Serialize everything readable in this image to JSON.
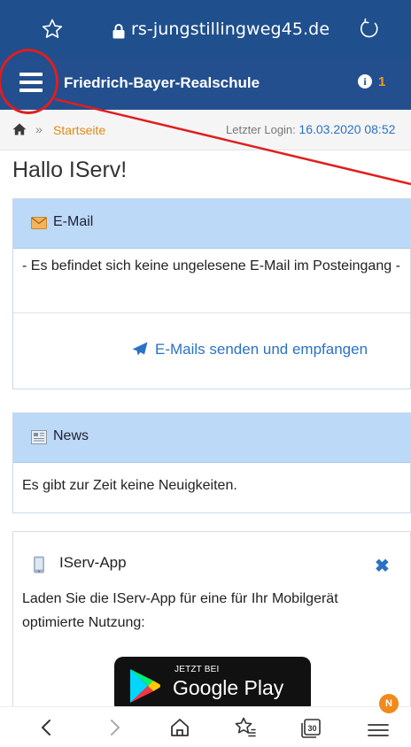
{
  "browser": {
    "url": "rs-jungstillingweg45.de"
  },
  "appbar": {
    "school_name": "Friedrich-Bayer-Realschule",
    "notification_count": "1",
    "info_glyph": "i"
  },
  "breadcrumb": {
    "separator": "»",
    "current": "Startseite",
    "login_label": "Letzter Login:",
    "login_value": "16.03.2020 08:52"
  },
  "greeting": "Hallo IServ!",
  "email_panel": {
    "title": "E-Mail",
    "message": "- Es befindet sich keine ungelesene E-Mail im Posteingang -",
    "link": "E-Mails senden und empfangen"
  },
  "news_panel": {
    "title": "News",
    "message": "Es gibt zur Zeit keine Neuigkeiten."
  },
  "app_panel": {
    "title": "IServ-App",
    "close_glyph": "✖",
    "description": "Laden Sie die IServ-App für eine für Ihr Mobilgerät optimierte Nutzung:",
    "badge_small": "JETZT BEI",
    "badge_big": "Google Play"
  },
  "bottom_nav": {
    "menu_badge": "N",
    "tabs_count": "30"
  },
  "colors": {
    "header": "#234f8e",
    "panel_head": "#bcd9f8",
    "link": "#2a72c4",
    "accent_orange": "#e08a14",
    "annotation_red": "#e01e1e"
  },
  "icons": [
    "star-icon",
    "lock-icon",
    "reload-icon",
    "menu-icon",
    "info-icon",
    "home-icon",
    "envelope-icon",
    "send-icon",
    "newspaper-icon",
    "phone-icon",
    "close-icon",
    "google-play-logo",
    "back-icon",
    "forward-icon",
    "home-nav-icon",
    "bookmarks-icon",
    "tabs-icon",
    "browser-menu-icon"
  ]
}
